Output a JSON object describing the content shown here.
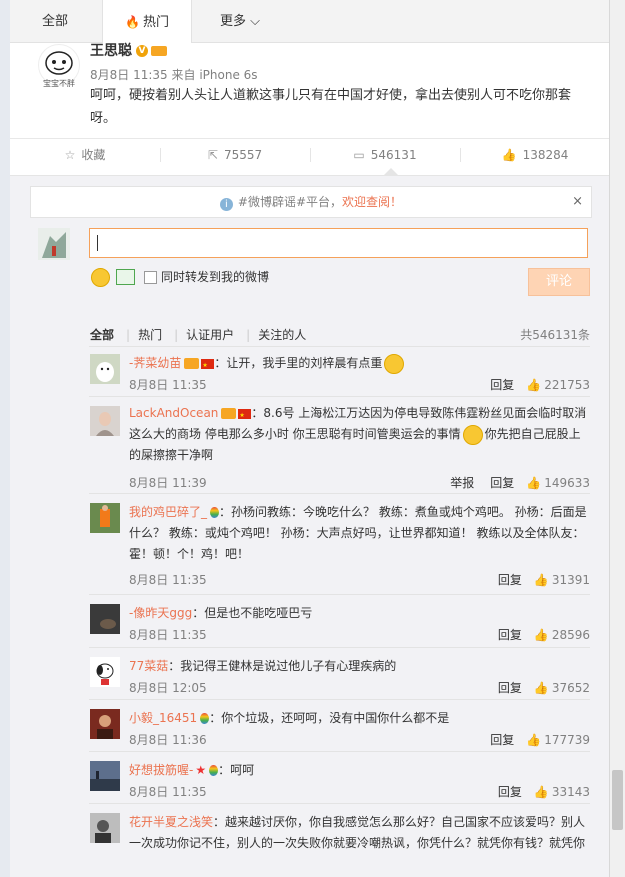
{
  "tabs": {
    "all": "全部",
    "hot": "热门",
    "more": "更多"
  },
  "post": {
    "author": "王思聪",
    "avatar_caption": "宝宝不胖",
    "date": "8月8日 11:35",
    "source": "来自 iPhone 6s",
    "text": "呵呵，硬按着别人头让人道歉这事儿只有在中国才好使，拿出去使别人可不吃你那套呀。"
  },
  "actions": {
    "favorite": "收藏",
    "repost": "75557",
    "comment": "546131",
    "like": "138284"
  },
  "rumor": {
    "prefix": "#微博辟谣#平台，",
    "highlight": "欢迎查阅！",
    "close": "×"
  },
  "composer": {
    "also_repost": "同时转发到我的微博",
    "submit": "评论"
  },
  "filters": {
    "all": "全部",
    "hot": "热门",
    "verified": "认证用户",
    "following": "关注的人",
    "total": "共546131条"
  },
  "comments": [
    {
      "user": "-荠菜幼苗",
      "text": "：让开，我手里的刘梓晨有点重",
      "time": "8月8日 11:35",
      "reply": "回复",
      "likes": "221753"
    },
    {
      "user": "LackAndOcean",
      "text": "：8.6号 上海松江万达因为停电导致陈伟霆粉丝见面会临时取消 这么大的商场 停电那么多小时 你王思聪有时间管奥运会的事情",
      "text2": "你先把自己屁股上的屎擦擦干净啊",
      "time": "8月8日 11:39",
      "report": "举报",
      "reply": "回复",
      "likes": "149633"
    },
    {
      "user": "我的鸡巴碎了_",
      "text": "：孙杨问教练：今晚吃什么？ 教练：煮鱼或炖个鸡吧。 孙杨：后面是什么？ 教练：或炖个鸡吧！ 孙杨：大声点好吗，让世界都知道！ 教练以及全体队友：霍！顿！个！鸡！吧！",
      "time": "8月8日 11:35",
      "reply": "回复",
      "likes": "31391"
    },
    {
      "user": "-像昨天ggg",
      "text": "：但是也不能吃哑巴亏",
      "time": "8月8日 11:35",
      "reply": "回复",
      "likes": "28596"
    },
    {
      "user": "77菜菇",
      "text": "：我记得王健林是说过他儿子有心理疾病的",
      "time": "8月8日 12:05",
      "reply": "回复",
      "likes": "37652"
    },
    {
      "user": "小毅_16451",
      "text": "：你个垃圾，还呵呵，没有中国你什么都不是",
      "time": "8月8日 11:36",
      "reply": "回复",
      "likes": "177739"
    },
    {
      "user": "好想拔筋喔-",
      "text": "：呵呵",
      "time": "8月8日 11:35",
      "reply": "回复",
      "likes": "33143"
    },
    {
      "user": "花开半夏之浅笑",
      "text": "：越来越讨厌你，你自我感觉怎么那么好？自己国家不应该爱吗？别人一次成功你记不住，别人的一次失败你就要冷嘲热讽，你凭什么？就凭你有钱？就凭你"
    }
  ]
}
